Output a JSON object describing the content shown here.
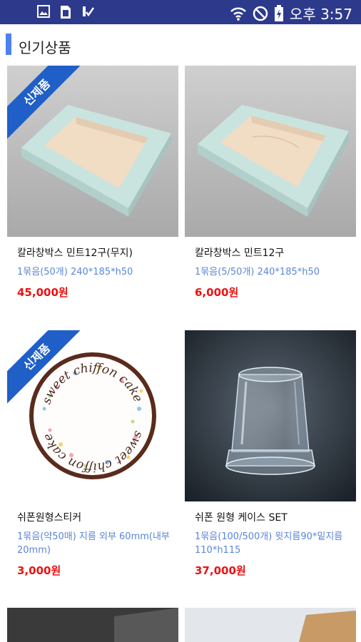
{
  "status_bar": {
    "time": "오후 3:57",
    "icons": [
      "image-icon",
      "sim-icon",
      "check-icon",
      "wifi-icon",
      "dnd-icon",
      "battery-icon"
    ]
  },
  "section": {
    "title": "인기상품"
  },
  "badge_label": "신제품",
  "products": [
    {
      "name": "칼라창박스 민트12구(무지)",
      "spec": "1묶음(50개) 240*185*h50",
      "price": "45,000원",
      "badge": true
    },
    {
      "name": "칼라창박스 민트12구",
      "spec": "1묶음(5/50개) 240*185*h50",
      "price": "6,000원",
      "badge": false
    },
    {
      "name": "쉬폰원형스티커",
      "spec": "1묶음(약50매) 지름 외부 60mm(내부20mm)",
      "price": "3,000원",
      "badge": true
    },
    {
      "name": "쉬폰 원형 케이스 SET",
      "spec": "1묶음(100/500개) 윗지름90*밑지름110*h115",
      "price": "37,000원",
      "badge": false
    }
  ],
  "sticker_text": "sweet chiffon cake",
  "colors": {
    "status_bar": "#2d3a8c",
    "accent": "#4b82f0",
    "badge": "#1f5fc7",
    "price": "#ee1111",
    "spec": "#5a86d8"
  }
}
